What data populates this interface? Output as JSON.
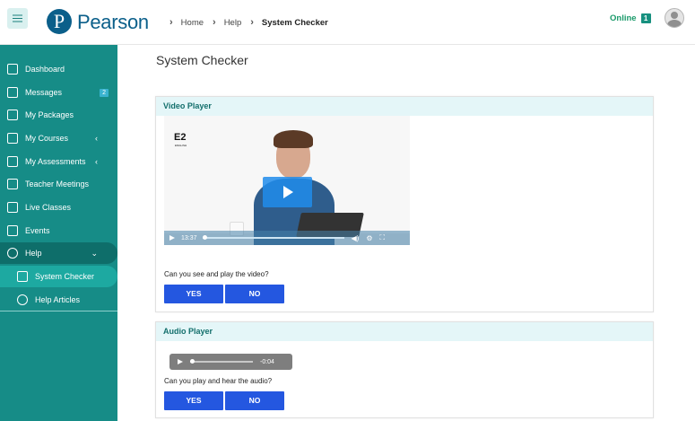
{
  "brand": {
    "logo_letter": "P",
    "name": "Pearson",
    "colors": {
      "primary": "#0b5f8a",
      "sidebar": "#168c87",
      "button": "#2457e0",
      "status": "#1a9a6a"
    }
  },
  "header": {
    "menu_icon": "hamburger-icon",
    "breadcrumbs": [
      "Home",
      "Help",
      "System Checker"
    ],
    "status_label": "Online",
    "status_count": "1"
  },
  "sidebar": {
    "items": [
      {
        "label": "Dashboard",
        "icon": "home-icon"
      },
      {
        "label": "Messages",
        "icon": "envelope-icon",
        "count": "2"
      },
      {
        "label": "My Packages",
        "icon": "bag-icon"
      },
      {
        "label": "My Courses",
        "icon": "graduation-cap-icon",
        "chevron": "‹"
      },
      {
        "label": "My Assessments",
        "icon": "clipboard-icon",
        "chevron": "‹"
      },
      {
        "label": "Teacher Meetings",
        "icon": "chat-icon"
      },
      {
        "label": "Live Classes",
        "icon": "presentation-icon"
      },
      {
        "label": "Events",
        "icon": "calendar-icon"
      },
      {
        "label": "Help",
        "icon": "lifebuoy-icon",
        "chevron": "⌄"
      },
      {
        "label": "System Checker",
        "icon": "list-icon"
      },
      {
        "label": "Help Articles",
        "icon": "lifebuoy-icon"
      }
    ]
  },
  "main": {
    "title": "System Checker",
    "video_card": {
      "heading": "Video Player",
      "brand_mark": "E2",
      "brand_sub": "ENGLISH",
      "player": {
        "time": "13:37",
        "progress": 0.0
      },
      "question": "Can you see and play the video?",
      "yes_label": "YES",
      "no_label": "NO"
    },
    "audio_card": {
      "heading": "Audio Player",
      "player": {
        "time": "-0:04",
        "progress": 0.0
      },
      "question": "Can you play and hear the audio?",
      "yes_label": "YES",
      "no_label": "NO"
    }
  }
}
